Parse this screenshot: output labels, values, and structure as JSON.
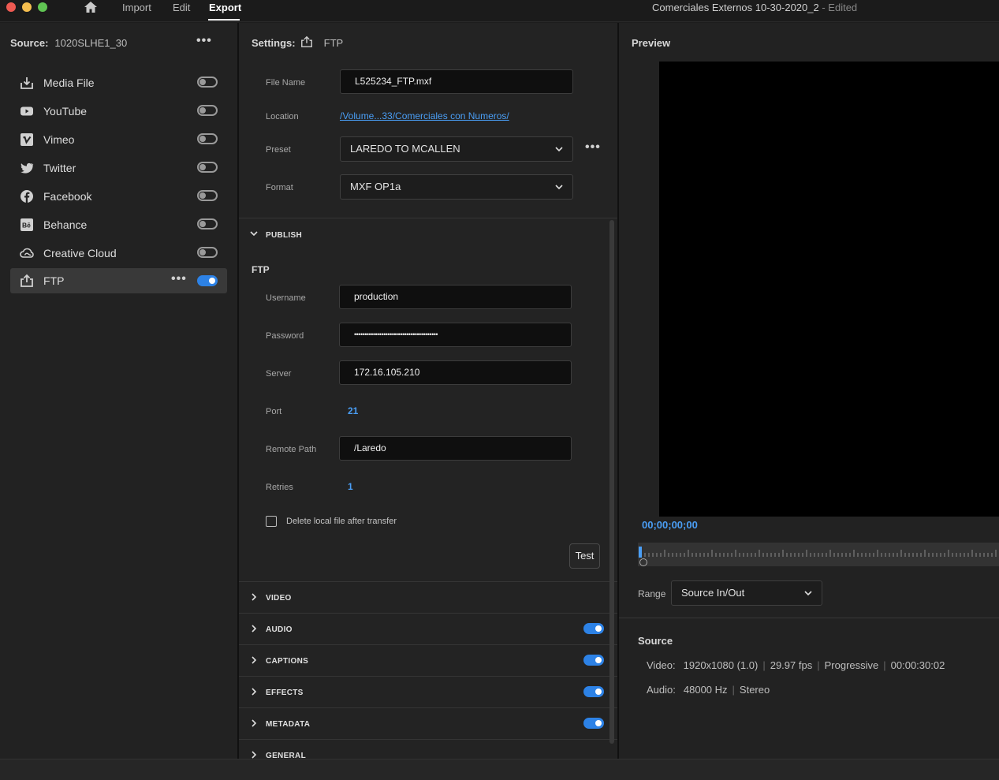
{
  "menu": {
    "import": "Import",
    "edit": "Edit",
    "export": "Export"
  },
  "document": {
    "title": "Comerciales Externos 10-30-2020_2",
    "status": " - Edited"
  },
  "source": {
    "label": "Source:",
    "value": "1020SLHE1_30"
  },
  "destinations": [
    {
      "label": "Media File",
      "icon": "media-file-icon",
      "enabled": false
    },
    {
      "label": "YouTube",
      "icon": "youtube-icon",
      "enabled": false
    },
    {
      "label": "Vimeo",
      "icon": "vimeo-icon",
      "enabled": false
    },
    {
      "label": "Twitter",
      "icon": "twitter-icon",
      "enabled": false
    },
    {
      "label": "Facebook",
      "icon": "facebook-icon",
      "enabled": false
    },
    {
      "label": "Behance",
      "icon": "behance-icon",
      "enabled": false
    },
    {
      "label": "Creative Cloud",
      "icon": "creative-cloud-icon",
      "enabled": false
    },
    {
      "label": "FTP",
      "icon": "share-icon",
      "enabled": true
    }
  ],
  "settings": {
    "label": "Settings:",
    "target": "FTP",
    "file_name_label": "File Name",
    "file_name": "L525234_FTP.mxf",
    "location_label": "Location",
    "location": "/Volume...33/Comerciales con Numeros/",
    "preset_label": "Preset",
    "preset": "LAREDO TO MCALLEN",
    "format_label": "Format",
    "format": "MXF OP1a"
  },
  "publish": {
    "header": "PUBLISH",
    "ftp_title": "FTP",
    "username_label": "Username",
    "username": "production",
    "password_label": "Password",
    "password": "••••••••••••••••••••••••••••••••••••••••",
    "server_label": "Server",
    "server": "172.16.105.210",
    "port_label": "Port",
    "port": "21",
    "remote_path_label": "Remote Path",
    "remote_path": "/Laredo",
    "retries_label": "Retries",
    "retries": "1",
    "delete_local_label": "Delete local file after transfer",
    "delete_local_checked": false,
    "test_button": "Test"
  },
  "sections": [
    {
      "label": "VIDEO",
      "toggle": null
    },
    {
      "label": "AUDIO",
      "toggle": true
    },
    {
      "label": "CAPTIONS",
      "toggle": true
    },
    {
      "label": "EFFECTS",
      "toggle": true
    },
    {
      "label": "METADATA",
      "toggle": true
    },
    {
      "label": "GENERAL",
      "toggle": null
    }
  ],
  "preview": {
    "title": "Preview",
    "timecode": "00;00;00;00",
    "range_label": "Range",
    "range_value": "Source In/Out"
  },
  "source_info": {
    "title": "Source",
    "video_label": "Video:",
    "video_resolution": "1920x1080 (1.0)",
    "video_fps": "29.97 fps",
    "video_scan": "Progressive",
    "video_duration": "00:00:30:02",
    "audio_label": "Audio:",
    "audio_rate": "48000 Hz",
    "audio_channels": "Stereo"
  },
  "colors": {
    "accent": "#2d82e6",
    "link": "#4a9ef5",
    "background": "#1d1d1d"
  }
}
